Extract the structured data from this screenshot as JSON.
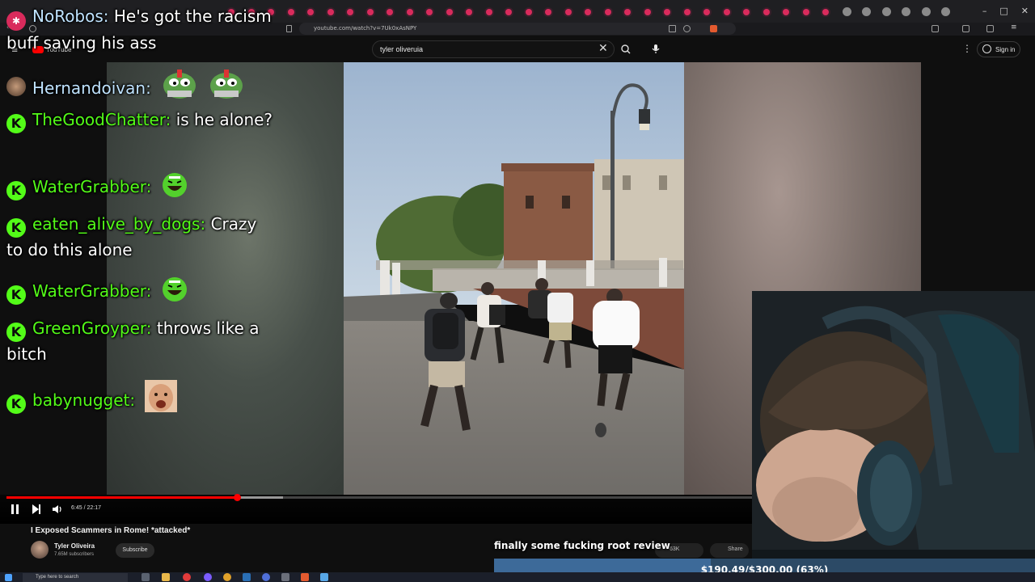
{
  "browser": {
    "url": "youtube.com/watch?v=7Uk0xAsNPY"
  },
  "youtube": {
    "logo_text": "YouTube",
    "search_query": "tyler oliveruia",
    "sign_in_label": "Sign in",
    "more_icon": "kebab-icon"
  },
  "player": {
    "time": "6:45 / 22:17",
    "progress": 0.3,
    "buffered": 0.36,
    "state": "playing"
  },
  "video": {
    "title": "I Exposed Scammers in Rome! *attacked*",
    "channel_name": "Tyler Oliveira",
    "channel_subs": "7.65M subscribers",
    "subscribe_label": "Subscribe",
    "likes": "63K",
    "share_label": "Share"
  },
  "chat": [
    {
      "user": "NoRobos:",
      "message": "He's got the racism buff saving his ass",
      "user_color": "#bfe3ff",
      "badge": "star"
    },
    {
      "user": "Hernandoivan:",
      "message": "",
      "user_color": "#bfe3ff",
      "emotes": [
        "pepe-knight-emote",
        "pepe-knight-emote"
      ]
    },
    {
      "user": "TheGoodChatter:",
      "message": "is he alone?",
      "user_color": "#53fc18",
      "badge": "kick"
    },
    {
      "user": "WaterGrabber:",
      "message": "",
      "user_color": "#53fc18",
      "badge": "kick",
      "emotes": [
        "laughing-emote"
      ]
    },
    {
      "user": "eaten_alive_by_dogs:",
      "message": "Crazy to do this alone",
      "user_color": "#53fc18",
      "badge": "kick"
    },
    {
      "user": "WaterGrabber:",
      "message": "",
      "user_color": "#53fc18",
      "badge": "kick",
      "emotes": [
        "laughing-emote"
      ]
    },
    {
      "user": "GreenGroyper:",
      "message": "throws like a bitch",
      "user_color": "#53fc18",
      "badge": "kick"
    },
    {
      "user": "babynugget:",
      "message": "",
      "user_color": "#53fc18",
      "badge": "kick",
      "emotes": [
        "face-emote"
      ]
    }
  ],
  "overlay": {
    "caption": "finally some fucking root review",
    "goal_text": "$190.49/$300.00 (63%)",
    "goal_fraction": 0.63
  },
  "taskbar": {
    "search_placeholder": "Type here to search"
  },
  "colors": {
    "kick_green": "#53fc18",
    "yt_red": "#ff0000",
    "goal_fill": "#3d6a99"
  }
}
